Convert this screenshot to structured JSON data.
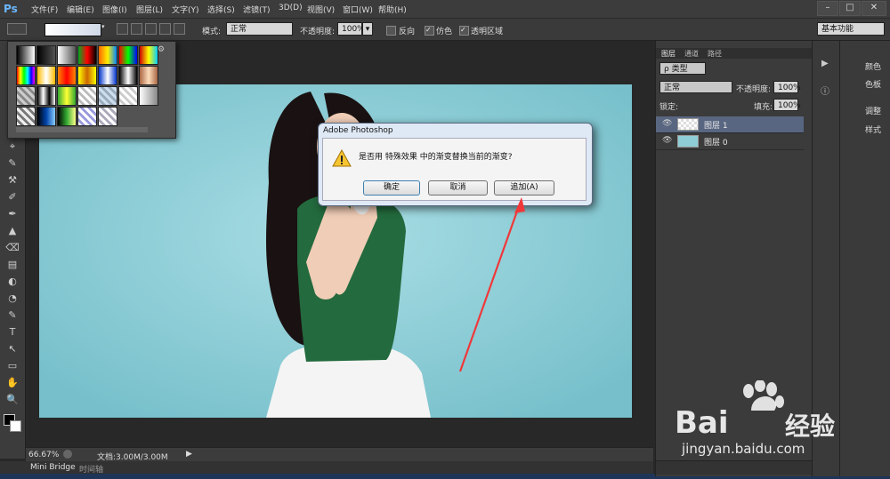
{
  "app": {
    "logo": "Ps"
  },
  "menu": [
    "文件(F)",
    "编辑(E)",
    "图像(I)",
    "图层(L)",
    "文字(Y)",
    "选择(S)",
    "滤镜(T)",
    "3D(D)",
    "视图(V)",
    "窗口(W)",
    "帮助(H)"
  ],
  "window_controls": [
    "–",
    "□",
    "✕"
  ],
  "options": {
    "mode_label": "模式:",
    "mode_value": "正常",
    "opacity_label": "不透明度:",
    "opacity_value": "100%",
    "reverse_label": "反向",
    "dither_label": "仿色",
    "transparency_label": "透明区域",
    "workspace_value": "基本功能"
  },
  "gradient_swatches": [
    "linear-gradient(90deg,#000,#fff)",
    "linear-gradient(90deg,#000,rgba(0,0,0,0))",
    "linear-gradient(90deg,#fff,rgba(255,255,255,0))",
    "linear-gradient(90deg,#0a2,#f00,#000)",
    "linear-gradient(90deg,#f60,#fe0,#08f)",
    "linear-gradient(90deg,#f00,#0f0,#00f)",
    "linear-gradient(90deg,#c00,#ff0,#0cf)",
    "linear-gradient(90deg,#f00,#ff0,#0f0,#0ff,#00f,#f0f)",
    "linear-gradient(90deg,#fb0,#fff,#fb0)",
    "linear-gradient(90deg,#f80,#f00,#f80)",
    "linear-gradient(90deg,#ff0,#c60,#ff0)",
    "linear-gradient(90deg,#03c,#fff,#03c)",
    "linear-gradient(90deg,#000,#fff,#000)",
    "linear-gradient(90deg,#a64,#fdb,#a64)",
    "repeating-linear-gradient(45deg,#ccc 0 3px,#888 3px 6px)",
    "linear-gradient(90deg,#000,#fff,#000,#fff)",
    "linear-gradient(90deg,#3a3,#ff3,#3a3)",
    "repeating-linear-gradient(45deg,#fff 0 3px,#bbb 3px 6px)",
    "repeating-linear-gradient(45deg,#cde 0 3px,#9ab 3px 6px)",
    "repeating-linear-gradient(45deg,#fff 0 3px,#ccc 3px 6px)",
    "linear-gradient(90deg,#fff,#888)",
    "repeating-linear-gradient(45deg,#eee 0 3px,#777 3px 6px)",
    "linear-gradient(90deg,#000,#04a,#8cf)",
    "linear-gradient(90deg,#000,#3a3,#ff8)",
    "repeating-linear-gradient(45deg,#fff 0 3px,#99d 3px 6px)",
    "repeating-linear-gradient(45deg,#fff 0 3px,#aab 3px 6px)"
  ],
  "tools": [
    "▭",
    "◌",
    "✂",
    "⌖",
    "✎",
    "⚒",
    "✐",
    "✒",
    "▲",
    "⌫",
    "▤",
    "◐",
    "◔",
    "✎",
    "T",
    "↖",
    "▭",
    "✋",
    "🔍"
  ],
  "doc": {
    "tab_close": "×"
  },
  "dialog": {
    "title": "Adobe Photoshop",
    "message": "是否用 特殊效果 中的渐变替换当前的渐变?",
    "ok": "确定",
    "cancel": "取消",
    "append": "追加(A)"
  },
  "status": {
    "zoom": "66.67%",
    "doc_info": "文档:3.00M/3.00M"
  },
  "bottom_tabs": [
    "Mini Bridge",
    "时间轴"
  ],
  "layers_panel": {
    "tabs": [
      "图层",
      "通道",
      "路径"
    ],
    "kind_value": "ρ 类型",
    "blend_value": "正常",
    "opacity_label": "不透明度:",
    "opacity_value": "100%",
    "lock_label": "锁定:",
    "fill_label": "填充:",
    "fill_value": "100%",
    "layers": [
      {
        "name": "图层 1"
      },
      {
        "name": "图层 0"
      }
    ]
  },
  "mini_panel": [
    "颜色",
    "色板",
    "调整",
    "样式"
  ],
  "watermark": {
    "brand": "Bai",
    "brand2": "经验",
    "url": "jingyan.baidu.com"
  },
  "colors": {
    "canvas_bg": "#8ecdd6",
    "dialog_bg": "#dfe9f5",
    "arrow": "#f0383a",
    "accent": "#6bb6ff"
  }
}
